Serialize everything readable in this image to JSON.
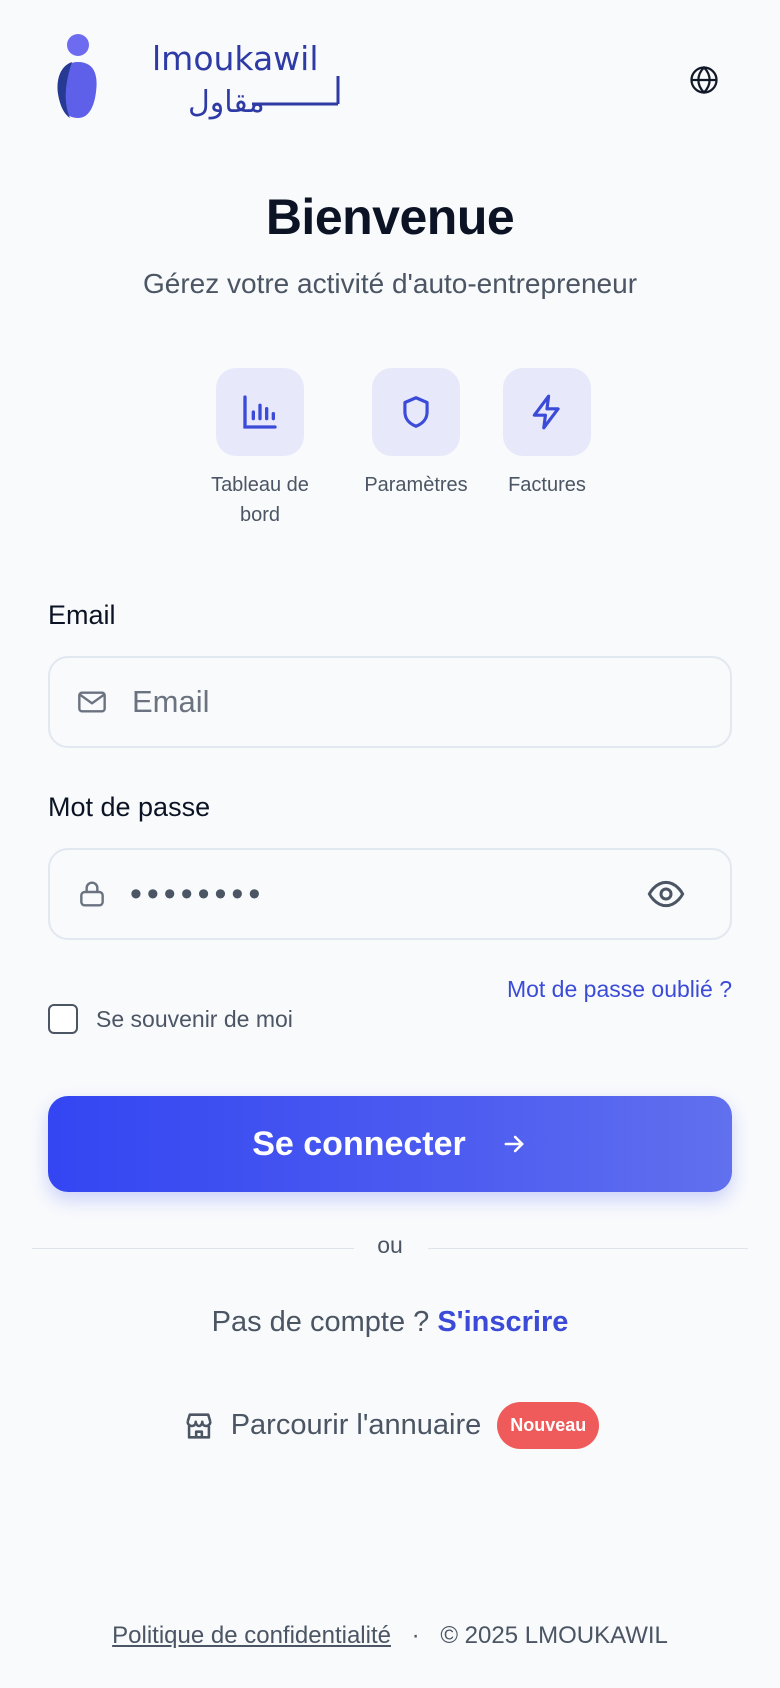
{
  "brand": {
    "name": "lmoukawil",
    "logo_latin": "lmoukawil",
    "logo_arabic": "مقاول",
    "color": "#2f3ba5",
    "mark_light": "#6d6cf0",
    "mark_dark": "#273a93"
  },
  "header": {
    "language_icon": "globe-icon"
  },
  "hero": {
    "title": "Bienvenue",
    "subtitle": "Gérez votre activité d'auto-entrepreneur"
  },
  "features": [
    {
      "label": "Tableau de bord",
      "icon": "bar-chart-icon"
    },
    {
      "label": "Paramètres",
      "icon": "shield-icon"
    },
    {
      "label": "Factures",
      "icon": "lightning-icon"
    }
  ],
  "form": {
    "email_label": "Email",
    "email_placeholder": "Email",
    "email_value": "",
    "password_label": "Mot de passe",
    "password_value_masked": "••••••••",
    "forgot_link": "Mot de passe oublié ?",
    "remember_label": "Se souvenir de moi",
    "remember_checked": false,
    "submit_label": "Se connecter"
  },
  "divider_text": "ou",
  "signup": {
    "prompt": "Pas de compte ?",
    "link": "S'inscrire"
  },
  "directory": {
    "label": "Parcourir l'annuaire",
    "badge": "Nouveau"
  },
  "footer": {
    "privacy_link": "Politique de confidentialité",
    "separator": "·",
    "copyright": "© 2025 LMOUKAWIL"
  },
  "colors": {
    "accent": "#3b4bd8",
    "button_start": "#3346f2",
    "button_end": "#6170ee",
    "badge": "#ef5a5a",
    "tile_bg": "#e7e9fb",
    "background": "#f8fafc"
  }
}
